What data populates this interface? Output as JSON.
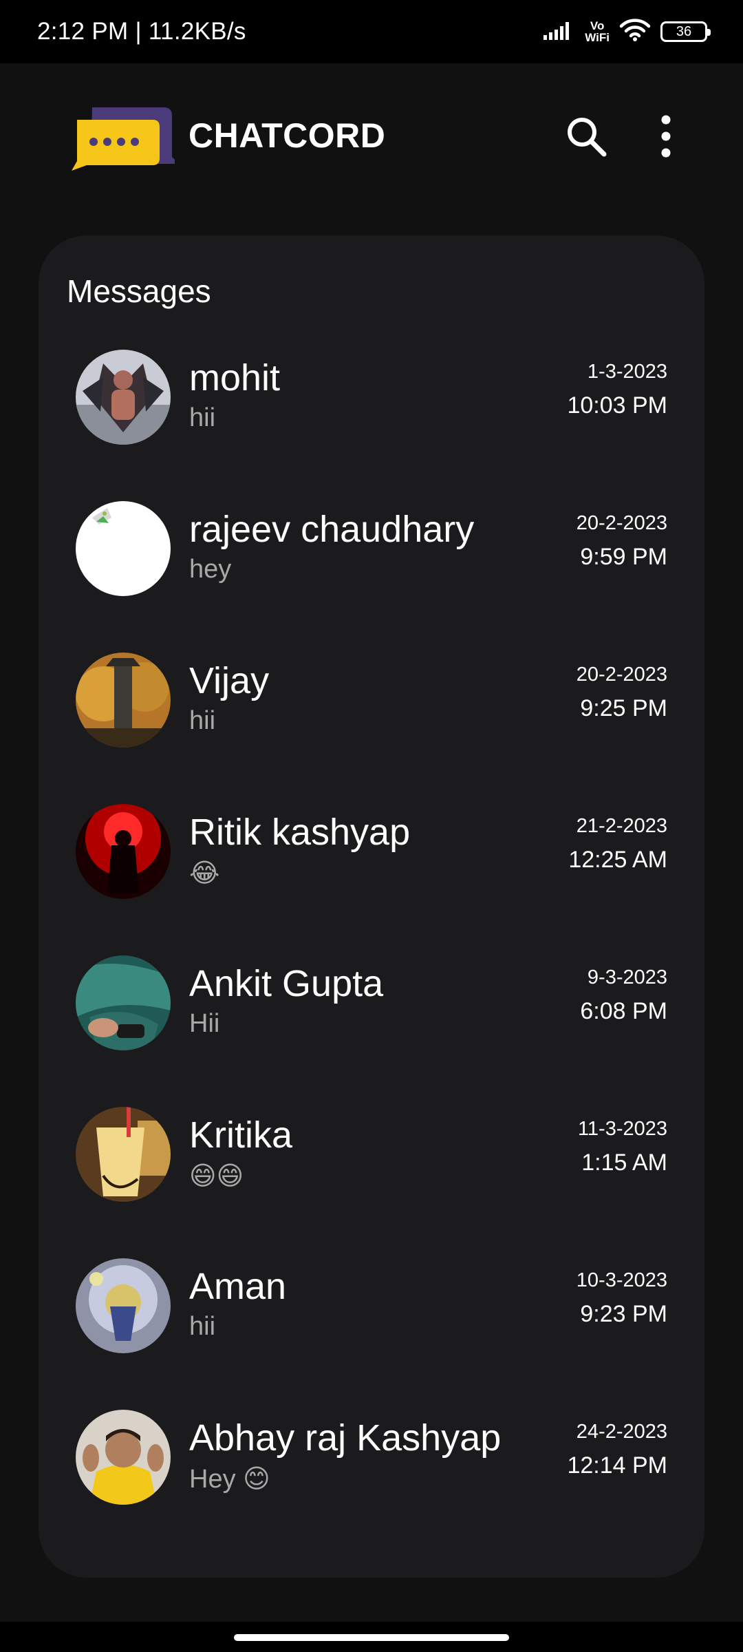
{
  "status_bar": {
    "time": "2:12 PM | 11.2KB/s",
    "vowifi_top": "Vo",
    "vowifi_bottom": "WiFi",
    "battery": "36",
    "icons": [
      "signal-icon",
      "vowifi-icon",
      "wifi-icon",
      "battery-icon"
    ]
  },
  "header": {
    "title": "CHATCORD",
    "logo_icon": "chat-bubble-logo-icon",
    "search_icon": "search-icon",
    "more_icon": "more-vertical-icon",
    "colors": {
      "logo_yellow": "#f5c518",
      "logo_purple": "#4b3b7a"
    }
  },
  "messages": {
    "title": "Messages",
    "items": [
      {
        "name": "mohit",
        "preview": "hii",
        "date": "1-3-2023",
        "time": "10:03 PM"
      },
      {
        "name": "rajeev chaudhary",
        "preview": "hey",
        "date": "20-2-2023",
        "time": "9:59 PM"
      },
      {
        "name": "Vijay",
        "preview": "hii",
        "date": "20-2-2023",
        "time": "9:25 PM"
      },
      {
        "name": "Ritik kashyap",
        "preview": "😂",
        "date": "21-2-2023",
        "time": "12:25 AM"
      },
      {
        "name": "Ankit Gupta",
        "preview": "Hii",
        "date": "9-3-2023",
        "time": "6:08 PM"
      },
      {
        "name": "Kritika",
        "preview": "😄😄",
        "date": "11-3-2023",
        "time": "1:15 AM"
      },
      {
        "name": "Aman",
        "preview": "hii",
        "date": "10-3-2023",
        "time": "9:23 PM"
      },
      {
        "name": "Abhay raj Kashyap",
        "preview": "Hey 😊",
        "date": "24-2-2023",
        "time": "12:14 PM"
      }
    ]
  },
  "colors": {
    "background": "#111111",
    "card": "#1b1b1d",
    "preview_text": "#a8a8a8"
  }
}
